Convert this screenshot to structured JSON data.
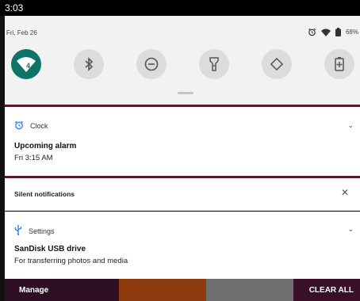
{
  "status_bar": {
    "time": "3:03"
  },
  "quick_settings": {
    "date": "Fri, Feb 26",
    "battery": "68%",
    "wifi_badge": "4",
    "tiles": [
      {
        "name": "wifi",
        "active": true
      },
      {
        "name": "bluetooth",
        "active": false
      },
      {
        "name": "do-not-disturb",
        "active": false
      },
      {
        "name": "flashlight",
        "active": false
      },
      {
        "name": "auto-rotate",
        "active": false
      },
      {
        "name": "battery-saver",
        "active": false
      }
    ]
  },
  "clock_notification": {
    "app": "Clock",
    "title": "Upcoming alarm",
    "text": "Fri 3:15 AM"
  },
  "silent_section": {
    "label": "Silent notifications"
  },
  "settings_notification": {
    "app": "Settings",
    "title": "SanDisk USB drive",
    "text": "For transferring photos and media"
  },
  "bottom_bar": {
    "manage": "Manage",
    "clear_all": "CLEAR ALL"
  },
  "colors": {
    "accent": "#0f7468",
    "band": "#5a1830",
    "bottom": "#2e0e22"
  }
}
